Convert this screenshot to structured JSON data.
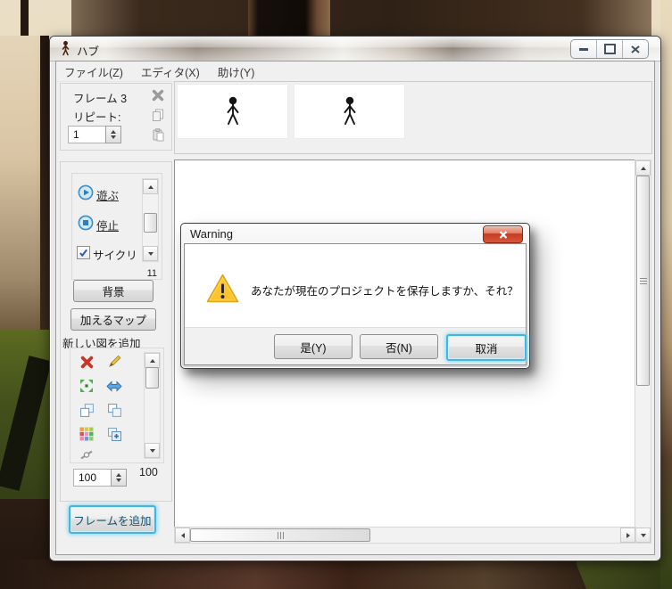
{
  "window": {
    "title": "ハブ",
    "menu": [
      "ファイル(Z)",
      "エディタ(X)",
      "助け(Y)"
    ]
  },
  "frame_panel": {
    "frame_label": "フレーム 3",
    "repeat_label": "リピート:",
    "repeat_value": "1"
  },
  "tools": {
    "play_label": "遊ぶ",
    "stop_label": "停止",
    "cycle_label": "サイクリ",
    "speed_value": "11",
    "background_button": "背景",
    "add_map_button": "加えるマップ",
    "add_figure_label": "新しい図を追加",
    "scale_value": "100",
    "scale_readout": "100",
    "add_frame_button": "フレームを追加"
  },
  "dialog": {
    "title": "Warning",
    "message": "あなたが現在のプロジェクトを保存しますか、それ？",
    "yes_button": "是(Y)",
    "no_button": "否(N)",
    "cancel_button": "取消"
  },
  "colors": {
    "focus_accent": "#45b5e0",
    "close_button_red": "#c23c22",
    "client_bg": "#f0f0f0"
  }
}
